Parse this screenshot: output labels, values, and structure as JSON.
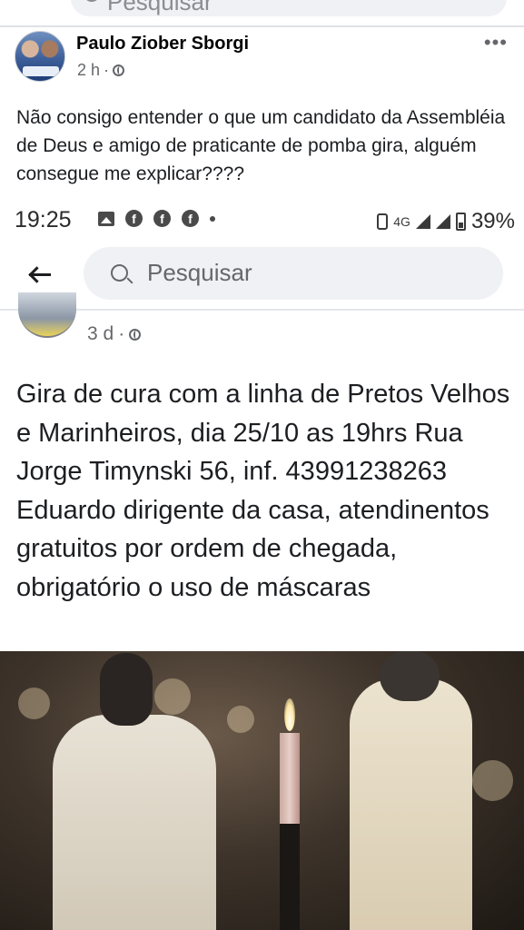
{
  "top_search": {
    "placeholder": "Pesquisar"
  },
  "post1": {
    "author": "Paulo Ziober Sborgi",
    "time": "2 h",
    "privacy_icon": "globe-icon",
    "more_icon": "more-options-icon",
    "text": "Não consigo entender o que um candidato da Assembléia de Deus e amigo de praticante de pomba gira, alguém consegue me explicar????"
  },
  "status_bar": {
    "time": "19:25",
    "network": "4G",
    "battery": "39%",
    "notification_icons": [
      "image-icon",
      "facebook-icon",
      "facebook-icon",
      "facebook-icon",
      "dot-icon"
    ]
  },
  "search_bar": {
    "back_icon": "back-arrow-icon",
    "placeholder": "Pesquisar"
  },
  "post2": {
    "time": "3 d",
    "privacy_icon": "globe-icon",
    "text": "Gira de cura com a linha de Pretos Velhos e Marinheiros,  dia 25/10 as 19hrs Rua Jorge Timynski 56, inf. 43991238263 Eduardo dirigente da casa,  atendinentos gratuitos por ordem de chegada, obrigatório o uso de máscaras"
  }
}
